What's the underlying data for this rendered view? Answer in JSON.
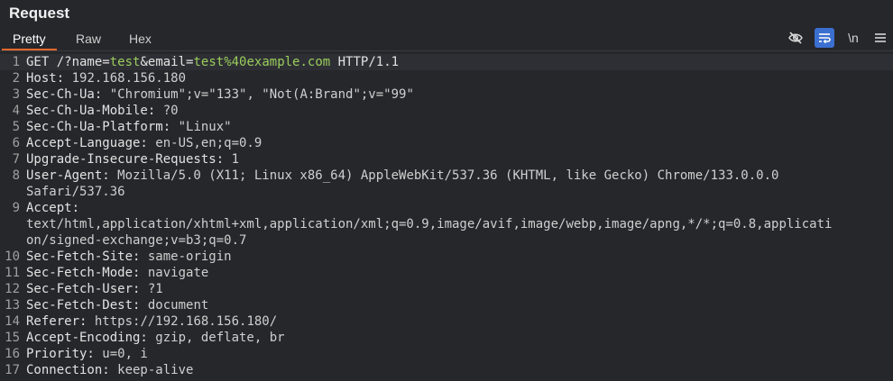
{
  "panel": {
    "title": "Request"
  },
  "tabs": [
    "Pretty",
    "Raw",
    "Hex"
  ],
  "toolbar": {
    "hide_icon": "eye-slash-icon",
    "wrap_icon": "wrap-lines-icon",
    "newline_label": "\\n",
    "menu_icon": "hamburger-menu-icon",
    "active_color": "#3b6fd0",
    "accent_color": "#e8692c"
  },
  "request_line": {
    "method_path": "GET /?",
    "p1_key": "name",
    "eq1": "=",
    "p1_val": "test",
    "amp": "&",
    "p2_key": "email",
    "eq2": "=",
    "p2_val": "test%40example.com",
    "protocol": " HTTP/1.1"
  },
  "line_numbers": [
    "1",
    "2",
    "3",
    "4",
    "5",
    "6",
    "7",
    "8",
    "9",
    "10",
    "11",
    "12",
    "13",
    "14",
    "15",
    "16",
    "17"
  ],
  "headers": [
    {
      "name": "Host:",
      "value": " 192.168.156.180"
    },
    {
      "name": "Sec-Ch-Ua:",
      "value": " \"Chromium\";v=\"133\", \"Not(A:Brand\";v=\"99\""
    },
    {
      "name": "Sec-Ch-Ua-Mobile:",
      "value": " ?0"
    },
    {
      "name": "Sec-Ch-Ua-Platform:",
      "value": " \"Linux\""
    },
    {
      "name": "Accept-Language:",
      "value": " en-US,en;q=0.9"
    },
    {
      "name": "Upgrade-Insecure-Requests:",
      "value": " 1"
    },
    {
      "name": "User-Agent:",
      "value": " Mozilla/5.0 (X11; Linux x86_64) AppleWebKit/537.36 (KHTML, like Gecko) Chrome/133.0.0.0",
      "cont": "Safari/537.36"
    },
    {
      "name": "Accept:",
      "value": "",
      "cont": "text/html,application/xhtml+xml,application/xml;q=0.9,image/avif,image/webp,image/apng,*/*;q=0.8,applicati",
      "cont2": "on/signed-exchange;v=b3;q=0.7"
    },
    {
      "name": "Sec-Fetch-Site:",
      "value": " same-origin"
    },
    {
      "name": "Sec-Fetch-Mode:",
      "value": " navigate"
    },
    {
      "name": "Sec-Fetch-User:",
      "value": " ?1"
    },
    {
      "name": "Sec-Fetch-Dest:",
      "value": " document"
    },
    {
      "name": "Referer:",
      "value": " https://192.168.156.180/"
    },
    {
      "name": "Accept-Encoding:",
      "value": " gzip, deflate, br"
    },
    {
      "name": "Priority:",
      "value": " u=0, i"
    },
    {
      "name": "Connection:",
      "value": " keep-alive"
    }
  ]
}
